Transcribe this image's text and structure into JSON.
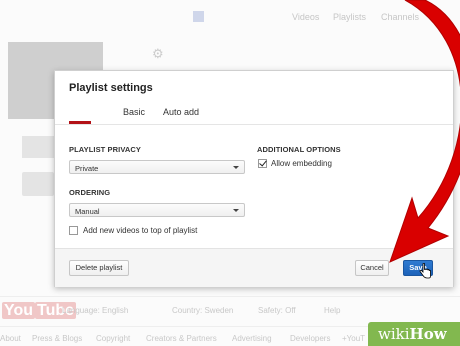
{
  "background": {
    "tabs": [
      "Videos",
      "Playlists",
      "Channels"
    ],
    "footer_controls": [
      "Language: English",
      "Country: Sweden",
      "Safety: Off",
      "Help"
    ],
    "footer_links": [
      "About",
      "Press & Blogs",
      "Copyright",
      "Creators & Partners",
      "Advertising",
      "Developers",
      "+YouT"
    ],
    "logo": {
      "you": "You",
      "tube": "Tube"
    }
  },
  "dialog": {
    "title": "Playlist settings",
    "tabs": [
      {
        "label": "Basic",
        "active": true
      },
      {
        "label": "Auto add",
        "active": false
      }
    ],
    "privacy": {
      "label": "PLAYLIST PRIVACY",
      "value": "Private"
    },
    "additional": {
      "label": "ADDITIONAL OPTIONS",
      "allow_embedding": {
        "label": "Allow embedding",
        "checked": true
      }
    },
    "ordering": {
      "label": "ORDERING",
      "value": "Manual"
    },
    "add_to_top": {
      "label": "Add new videos to top of playlist",
      "checked": false
    },
    "buttons": {
      "delete": "Delete playlist",
      "cancel": "Cancel",
      "save": "Save"
    }
  },
  "watermark": {
    "wiki": "wiki",
    "how": "How"
  },
  "colors": {
    "accent_red": "#b31217",
    "save_blue": "#1c62b9",
    "arrow_red": "#d90000"
  },
  "icons": [
    "gear-icon",
    "red-arrow",
    "hand-cursor-icon"
  ]
}
